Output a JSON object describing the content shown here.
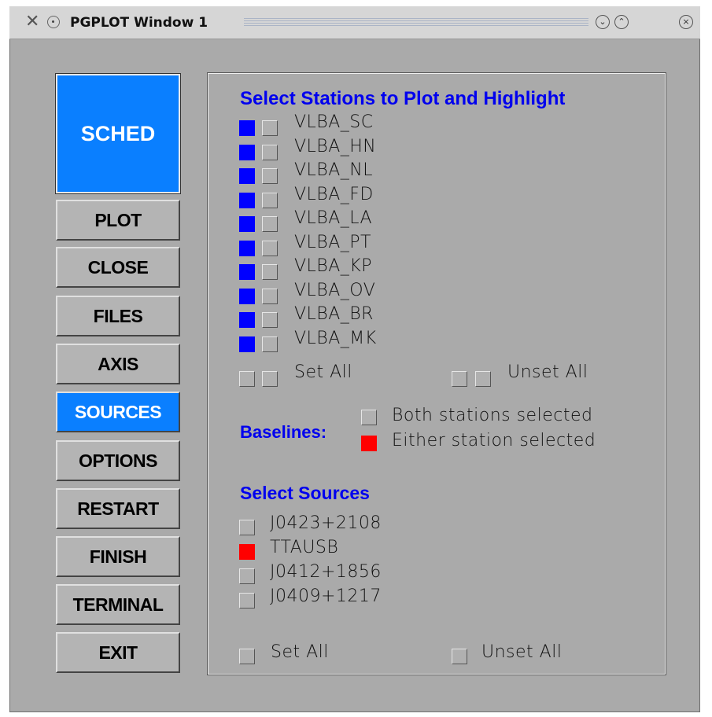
{
  "window": {
    "title": "PGPLOT Window 1"
  },
  "colors": {
    "accent": "#0a7fff",
    "heading": "#0000ee",
    "selected_blue": "#0000ff",
    "selected_red": "#ff0000",
    "background": "#aaaaaa"
  },
  "sched_label": "SCHED",
  "buttons": [
    {
      "label": "PLOT",
      "active": false
    },
    {
      "label": "CLOSE",
      "active": false
    },
    {
      "label": "FILES",
      "active": false
    },
    {
      "label": "AXIS",
      "active": false
    },
    {
      "label": "SOURCES",
      "active": true
    },
    {
      "label": "OPTIONS",
      "active": false
    },
    {
      "label": "RESTART",
      "active": false
    },
    {
      "label": "FINISH",
      "active": false
    },
    {
      "label": "TERMINAL",
      "active": false
    },
    {
      "label": "EXIT",
      "active": false
    }
  ],
  "stations": {
    "heading": "Select Stations to Plot and Highlight",
    "items": [
      {
        "name": "VLBA_SC",
        "plot": true,
        "highlight": false
      },
      {
        "name": "VLBA_HN",
        "plot": true,
        "highlight": false
      },
      {
        "name": "VLBA_NL",
        "plot": true,
        "highlight": false
      },
      {
        "name": "VLBA_FD",
        "plot": true,
        "highlight": false
      },
      {
        "name": "VLBA_LA",
        "plot": true,
        "highlight": false
      },
      {
        "name": "VLBA_PT",
        "plot": true,
        "highlight": false
      },
      {
        "name": "VLBA_KP",
        "plot": true,
        "highlight": false
      },
      {
        "name": "VLBA_OV",
        "plot": true,
        "highlight": false
      },
      {
        "name": "VLBA_BR",
        "plot": true,
        "highlight": false
      },
      {
        "name": "VLBA_MK",
        "plot": true,
        "highlight": false
      }
    ],
    "set_all": "Set All",
    "unset_all": "Unset All"
  },
  "baselines": {
    "label": "Baselines:",
    "options": [
      {
        "label": "Both stations selected",
        "selected": false
      },
      {
        "label": "Either station selected",
        "selected": true
      }
    ]
  },
  "sources": {
    "heading": "Select Sources",
    "items": [
      {
        "name": "J0423+2108",
        "selected": false
      },
      {
        "name": "TTAUSB",
        "selected": true
      },
      {
        "name": "J0412+1856",
        "selected": false
      },
      {
        "name": "J0409+1217",
        "selected": false
      }
    ],
    "set_all": "Set All",
    "unset_all": "Unset All"
  }
}
